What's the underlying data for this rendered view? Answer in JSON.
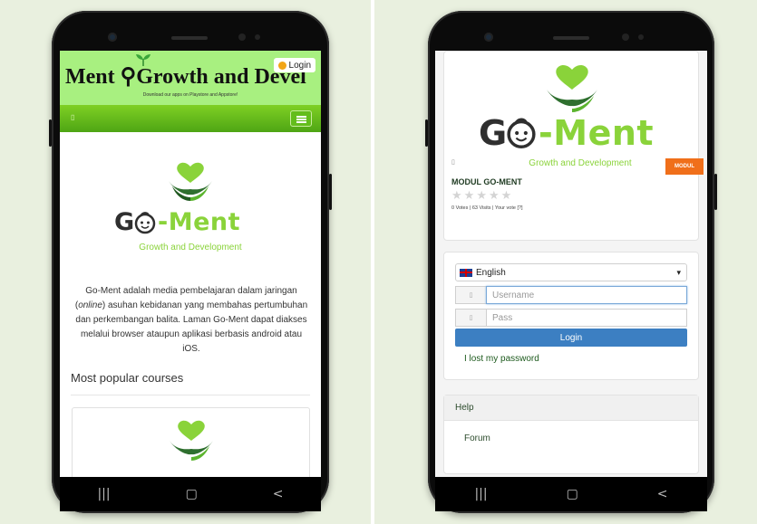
{
  "left_phone": {
    "header": {
      "title": "Ment ⚲Growth and Devel",
      "subtitle": "Download our apps on Playstore and Appstore!",
      "login_label": "Login"
    },
    "logo": {
      "brand_go": "G",
      "brand_ment": "-Ment",
      "tagline": "Growth and Development"
    },
    "description": {
      "part1": "Go-Ment adalah media pembelajaran dalam jaringan (",
      "online": "online",
      "part2": ") asuhan kebidanan yang membahas pertumbuhan dan perkembangan balita. Laman Go-Ment dapat diakses melalui browser ataupun aplikasi berbasis android atau iOS."
    },
    "popular_heading": "Most popular courses",
    "nav": {
      "recent": "|||",
      "home": "▢",
      "back": "<"
    }
  },
  "right_phone": {
    "course": {
      "brand_go": "G",
      "brand_ment": "-Ment",
      "tagline": "Growth and Development",
      "tag": "MODUL",
      "title": "MODUL GO-MENT",
      "stars": [
        "★",
        "★",
        "★",
        "★",
        "★"
      ],
      "votes": "0 Votes | 63 Visits | Your vote [?]"
    },
    "login": {
      "language": "English",
      "username_placeholder": "Username",
      "password_placeholder": "Pass",
      "submit_label": "Login",
      "lost_password": "I lost my password"
    },
    "help": {
      "heading": "Help",
      "forum": "Forum"
    },
    "nav": {
      "recent": "|||",
      "home": "▢",
      "back": "<"
    }
  },
  "colors": {
    "brand_green": "#8ad33a",
    "header_green": "#a8f080",
    "primary_blue": "#3c7fc2",
    "tag_orange": "#f06f1a"
  }
}
